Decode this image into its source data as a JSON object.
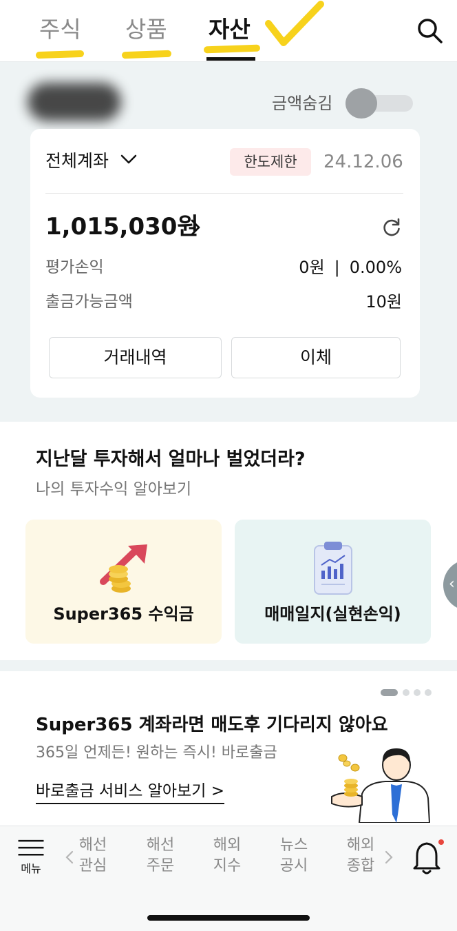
{
  "header": {
    "tabs": [
      {
        "label": "주식",
        "active": false
      },
      {
        "label": "상품",
        "active": false
      },
      {
        "label": "자산",
        "active": true
      }
    ],
    "highlight_color": "#f7d21c"
  },
  "account": {
    "hide_amount_label": "금액숨김",
    "hide_amount_on": false,
    "selector_label": "전체계좌",
    "limit_badge": "한도제한",
    "date": "24.12.06",
    "total": "1,015,030원",
    "rows": [
      {
        "label": "평가손익",
        "value": "0원",
        "percent": "0.00%"
      },
      {
        "label": "출금가능금액",
        "value": "10원"
      }
    ],
    "buttons": {
      "history": "거래내역",
      "transfer": "이체"
    }
  },
  "promo": {
    "title": "지난달 투자해서 얼마나 벌었더라?",
    "subtitle": "나의 투자수익 알아보기",
    "tiles": [
      {
        "label": "Super365 수익금",
        "bg": "#fdf8e6"
      },
      {
        "label": "매매일지(실현손익)",
        "bg": "#e8f4f3"
      }
    ]
  },
  "banner": {
    "title": "Super365 계좌라면 매도후 기다리지 않아요",
    "subtitle": "365일 언제든! 원하는 즉시! 바로출금",
    "link": "바로출금 서비스 알아보기 >",
    "page_count": 4,
    "page_active": 1
  },
  "bottom_nav": {
    "menu_label": "메뉴",
    "items": [
      {
        "line1": "해선",
        "line2": "관심"
      },
      {
        "line1": "해선",
        "line2": "주문"
      },
      {
        "line1": "해외",
        "line2": "지수"
      },
      {
        "line1": "뉴스",
        "line2": "공시"
      },
      {
        "line1": "해외",
        "line2": "종합"
      }
    ]
  }
}
